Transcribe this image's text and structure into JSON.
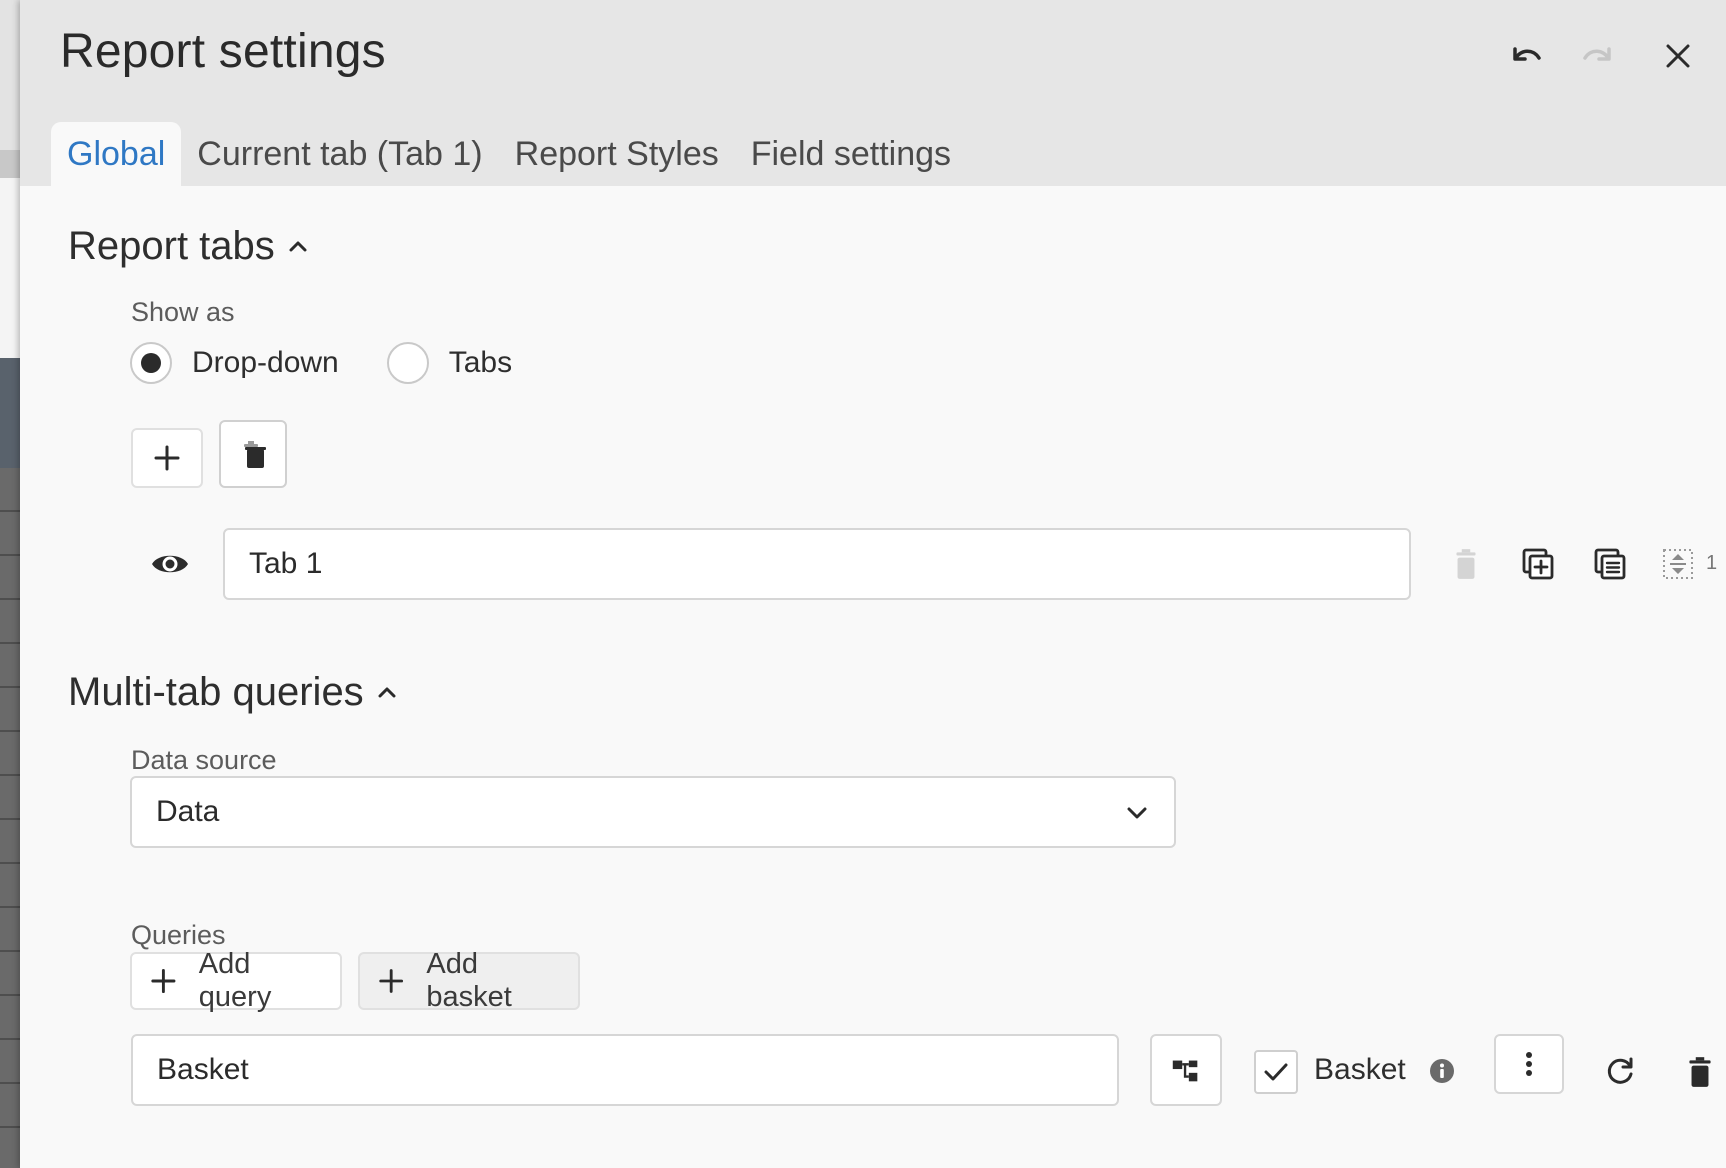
{
  "dialog": {
    "title": "Report settings"
  },
  "header_actions": [
    "undo-icon",
    "redo-icon",
    "close-icon"
  ],
  "tabs": [
    {
      "label": "Global",
      "active": true
    },
    {
      "label": "Current tab (Tab 1)",
      "active": false
    },
    {
      "label": "Report Styles",
      "active": false
    },
    {
      "label": "Field settings",
      "active": false
    }
  ],
  "report_tabs": {
    "title": "Report tabs",
    "show_as_label": "Show as",
    "options": [
      {
        "label": "Drop-down",
        "selected": true
      },
      {
        "label": "Tabs",
        "selected": false
      }
    ],
    "rows": [
      {
        "name": "Tab 1",
        "order": "1"
      }
    ]
  },
  "multi_tab": {
    "title": "Multi-tab queries",
    "data_source_label": "Data source",
    "data_source_value": "Data",
    "queries_label": "Queries",
    "add_query_label": "Add query",
    "add_basket_label": "Add basket",
    "query_rows": [
      {
        "name": "Basket",
        "checkbox_label": "Basket",
        "checked": true
      }
    ]
  },
  "colors": {
    "accent": "#2f78c4",
    "header_bg": "#e6e6e6",
    "dialog_bg": "#f9f9f9"
  }
}
